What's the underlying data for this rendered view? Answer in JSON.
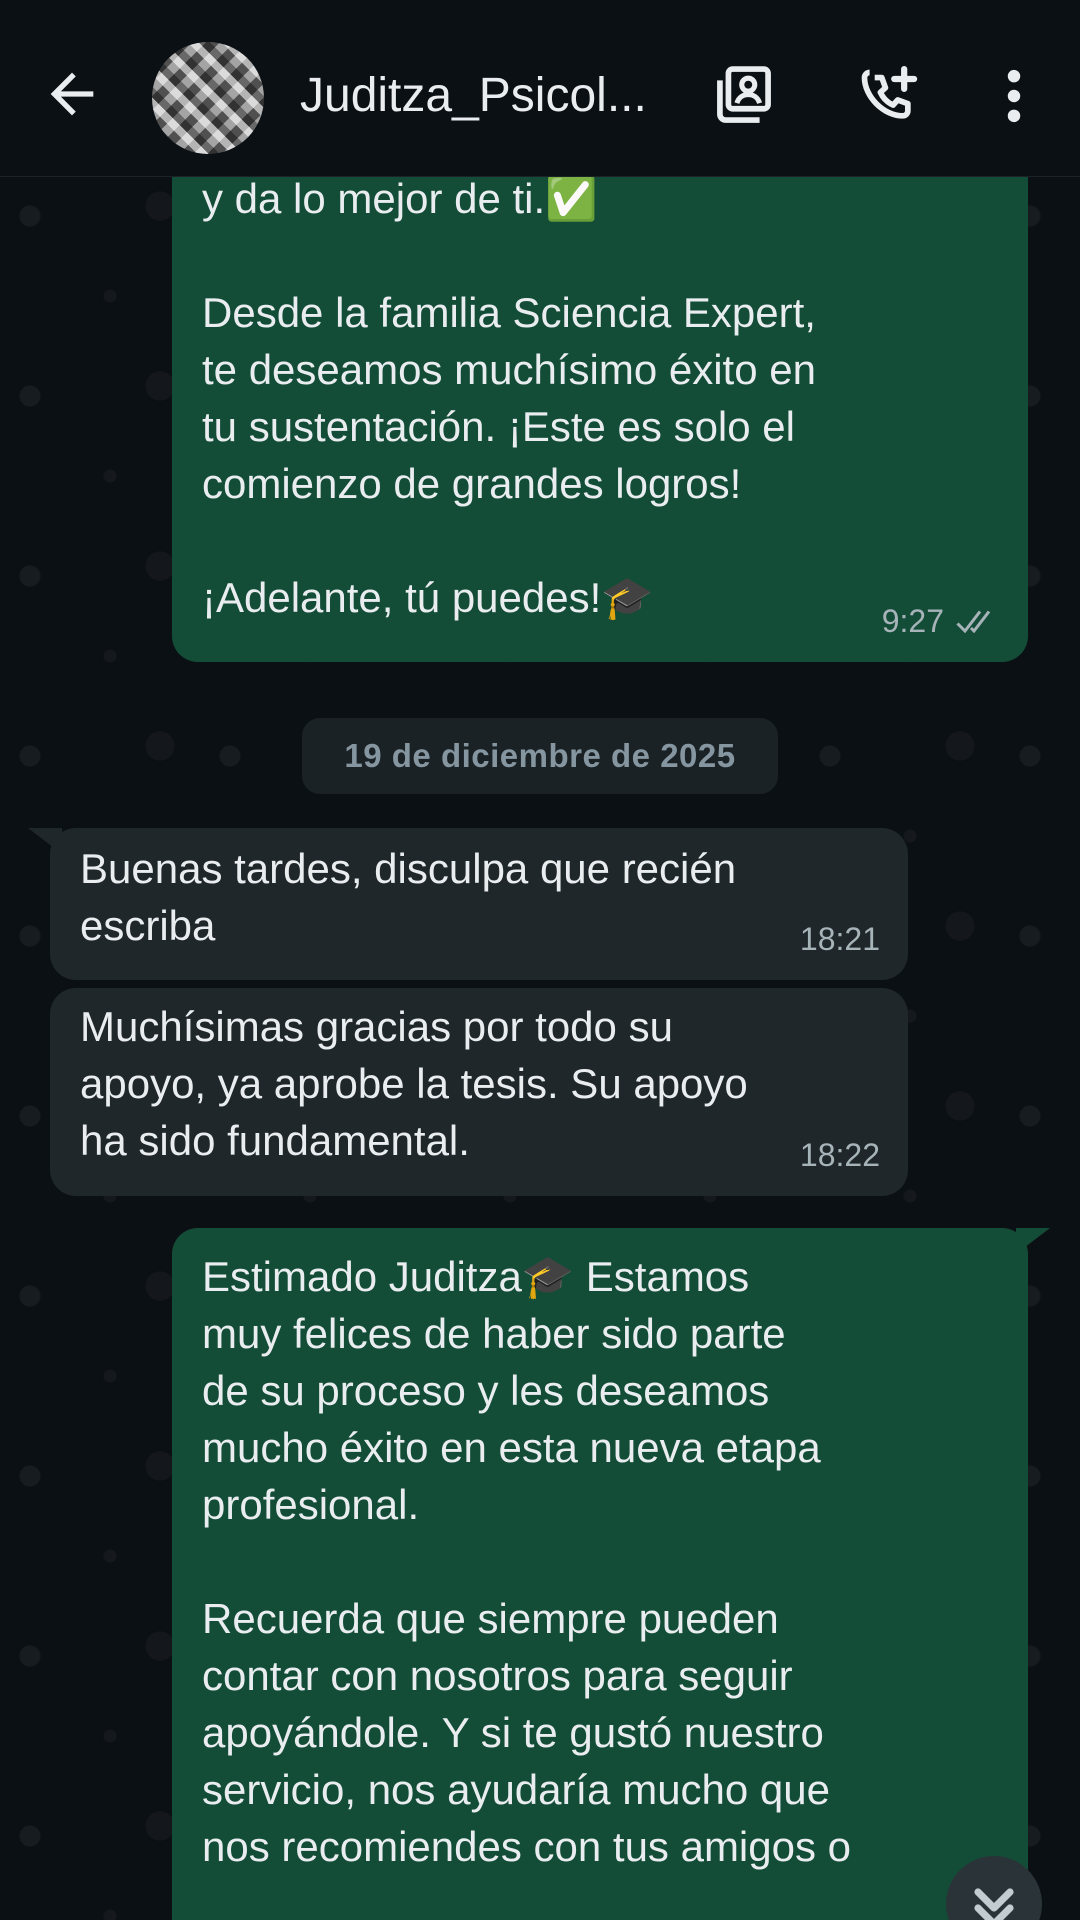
{
  "header": {
    "contact_name": "Juditza_Psicol...",
    "icons": [
      "back-arrow-icon",
      "contacts-icon",
      "add-call-icon",
      "more-vert-icon"
    ]
  },
  "chat": {
    "date_divider": "19 de diciembre de 2025",
    "messages": [
      {
        "direction": "out",
        "text": "y da lo mejor de ti.✅\n\nDesde la familia Sciencia Expert,\nte deseamos muchísimo éxito en\ntu sustentación. ¡Este es solo el\ncomienzo de grandes logros!\n\n¡Adelante, tú puedes!🎓",
        "time": "9:27",
        "status": "read"
      },
      {
        "direction": "in",
        "text": "Buenas tardes, disculpa que recién\nescriba",
        "time": "18:21"
      },
      {
        "direction": "in",
        "text": "Muchísimas gracias por todo su\napoyo, ya aprobe la tesis. Su apoyo\nha sido fundamental.",
        "time": "18:22"
      },
      {
        "direction": "out",
        "text": "Estimado Juditza🎓 Estamos\nmuy felices de haber sido parte\nde su proceso y les deseamos\nmucho éxito en esta nueva etapa\nprofesional.\n\nRecuerda que siempre pueden\ncontar con nosotros para seguir\napoyándole. Y si te gustó nuestro\nservicio, nos ayudaría mucho que\nnos recomiendes con tus amigos o"
      }
    ]
  },
  "colors": {
    "background": "#0b1014",
    "outgoing_bubble": "#144d37",
    "incoming_bubble": "#1f272a",
    "date_chip": "#1a2226"
  }
}
